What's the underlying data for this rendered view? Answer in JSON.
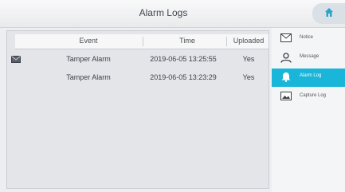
{
  "header": {
    "title": "Alarm Logs",
    "home_icon": "home-icon"
  },
  "table": {
    "columns": [
      "Event",
      "Time",
      "Uploaded"
    ],
    "rows": [
      {
        "event": "Tamper Alarm",
        "time": "2019-06-05 13:25:55",
        "uploaded": "Yes",
        "icon": "mail-icon"
      },
      {
        "event": "Tamper Alarm",
        "time": "2019-06-05 13:23:29",
        "uploaded": "Yes",
        "icon": ""
      }
    ]
  },
  "sidebar": {
    "items": [
      {
        "label": "Notice",
        "icon": "mail-icon",
        "active": false
      },
      {
        "label": "Message",
        "icon": "user-icon",
        "active": false
      },
      {
        "label": "Alarm Log",
        "icon": "bell-icon",
        "active": true
      },
      {
        "label": "Capture Log",
        "icon": "image-icon",
        "active": false
      }
    ]
  },
  "colors": {
    "accent": "#19b6d9",
    "background": "#eceef1"
  }
}
